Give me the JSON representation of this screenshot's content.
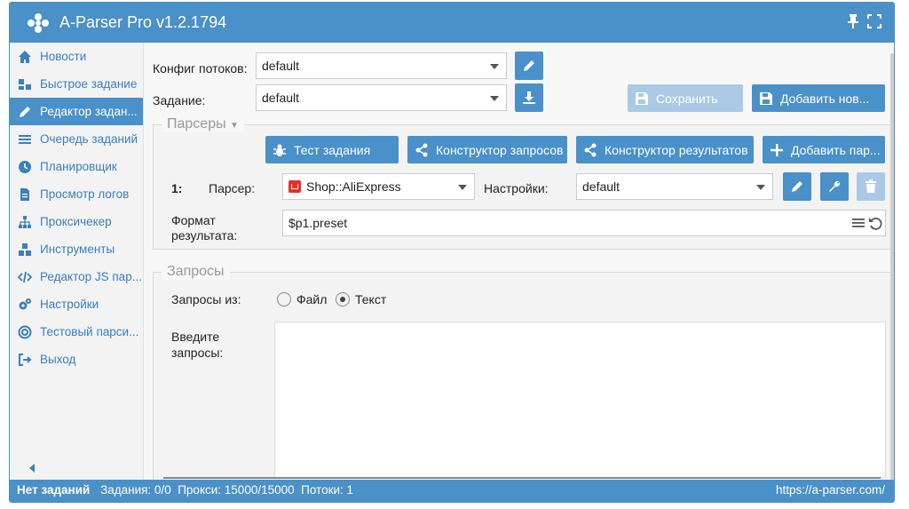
{
  "app": {
    "title": "A-Parser Pro v1.2.1794"
  },
  "sidebar": {
    "items": [
      {
        "label": "Новости",
        "icon": "home-icon",
        "active": false
      },
      {
        "label": "Быстрое задание",
        "icon": "tasks-icon",
        "active": false
      },
      {
        "label": "Редактор задан...",
        "icon": "pencil-icon",
        "active": true
      },
      {
        "label": "Очередь заданий",
        "icon": "list-icon",
        "active": false
      },
      {
        "label": "Планировщик",
        "icon": "clock-icon",
        "active": false
      },
      {
        "label": "Просмотр логов",
        "icon": "file-icon",
        "active": false
      },
      {
        "label": "Проксичекер",
        "icon": "sitemap-icon",
        "active": false
      },
      {
        "label": "Инструменты",
        "icon": "cubes-icon",
        "active": false
      },
      {
        "label": "Редактор JS пар...",
        "icon": "code-icon",
        "active": false
      },
      {
        "label": "Настройки",
        "icon": "gears-icon",
        "active": false
      },
      {
        "label": "Тестовый парси...",
        "icon": "target-icon",
        "active": false
      },
      {
        "label": "Выход",
        "icon": "sign-out-icon",
        "active": false
      }
    ]
  },
  "form": {
    "threads_label": "Конфиг потоков:",
    "threads_value": "default",
    "task_label": "Задание:",
    "task_value": "default",
    "save_label": "Сохранить",
    "add_new_label": "Добавить нов..."
  },
  "parsers": {
    "legend": "Парсеры",
    "test_task_label": "Тест задания",
    "query_builder_label": "Конструктор запросов",
    "result_builder_label": "Конструктор результатов",
    "add_parser_label": "Добавить пар...",
    "row_index": "1:",
    "parser_label": "Парсер:",
    "parser_value": "Shop::AliExpress",
    "settings_label": "Настройки:",
    "settings_value": "default",
    "format_label_line1": "Формат",
    "format_label_line2": "результата:",
    "format_value": "$p1.preset"
  },
  "queries": {
    "legend": "Запросы",
    "from_label": "Запросы из:",
    "option_file": "Файл",
    "option_text": "Текст",
    "selected": "Текст",
    "enter_label_line1": "Введите",
    "enter_label_line2": "запросы:",
    "text_value": ""
  },
  "status": {
    "no_tasks": "Нет заданий",
    "tasks": "Задания: 0/0",
    "proxies": "Прокси: 15000/15000",
    "threads": "Потоки: 1",
    "url": "https://a-parser.com/"
  },
  "colors": {
    "accent": "#4a90c9",
    "link": "#3a7fbf",
    "disabled": "#aac9e4",
    "aliexpress_red": "#e43225"
  }
}
